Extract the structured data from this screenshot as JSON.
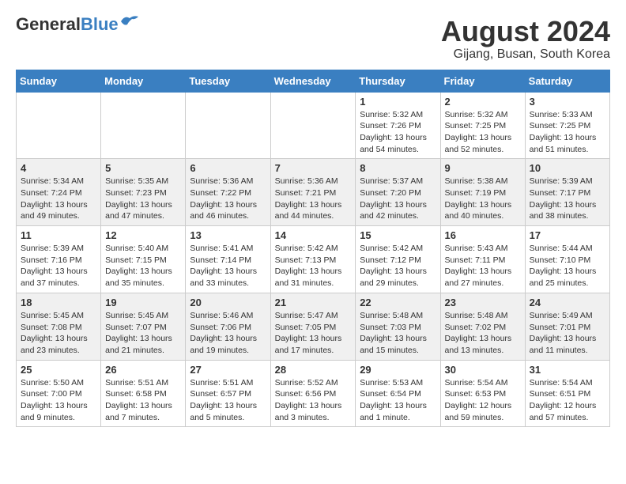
{
  "header": {
    "logo_general": "General",
    "logo_blue": "Blue",
    "month_year": "August 2024",
    "location": "Gijang, Busan, South Korea"
  },
  "days_of_week": [
    "Sunday",
    "Monday",
    "Tuesday",
    "Wednesday",
    "Thursday",
    "Friday",
    "Saturday"
  ],
  "weeks": [
    [
      {
        "day": "",
        "info": ""
      },
      {
        "day": "",
        "info": ""
      },
      {
        "day": "",
        "info": ""
      },
      {
        "day": "",
        "info": ""
      },
      {
        "day": "1",
        "info": "Sunrise: 5:32 AM\nSunset: 7:26 PM\nDaylight: 13 hours\nand 54 minutes."
      },
      {
        "day": "2",
        "info": "Sunrise: 5:32 AM\nSunset: 7:25 PM\nDaylight: 13 hours\nand 52 minutes."
      },
      {
        "day": "3",
        "info": "Sunrise: 5:33 AM\nSunset: 7:25 PM\nDaylight: 13 hours\nand 51 minutes."
      }
    ],
    [
      {
        "day": "4",
        "info": "Sunrise: 5:34 AM\nSunset: 7:24 PM\nDaylight: 13 hours\nand 49 minutes."
      },
      {
        "day": "5",
        "info": "Sunrise: 5:35 AM\nSunset: 7:23 PM\nDaylight: 13 hours\nand 47 minutes."
      },
      {
        "day": "6",
        "info": "Sunrise: 5:36 AM\nSunset: 7:22 PM\nDaylight: 13 hours\nand 46 minutes."
      },
      {
        "day": "7",
        "info": "Sunrise: 5:36 AM\nSunset: 7:21 PM\nDaylight: 13 hours\nand 44 minutes."
      },
      {
        "day": "8",
        "info": "Sunrise: 5:37 AM\nSunset: 7:20 PM\nDaylight: 13 hours\nand 42 minutes."
      },
      {
        "day": "9",
        "info": "Sunrise: 5:38 AM\nSunset: 7:19 PM\nDaylight: 13 hours\nand 40 minutes."
      },
      {
        "day": "10",
        "info": "Sunrise: 5:39 AM\nSunset: 7:17 PM\nDaylight: 13 hours\nand 38 minutes."
      }
    ],
    [
      {
        "day": "11",
        "info": "Sunrise: 5:39 AM\nSunset: 7:16 PM\nDaylight: 13 hours\nand 37 minutes."
      },
      {
        "day": "12",
        "info": "Sunrise: 5:40 AM\nSunset: 7:15 PM\nDaylight: 13 hours\nand 35 minutes."
      },
      {
        "day": "13",
        "info": "Sunrise: 5:41 AM\nSunset: 7:14 PM\nDaylight: 13 hours\nand 33 minutes."
      },
      {
        "day": "14",
        "info": "Sunrise: 5:42 AM\nSunset: 7:13 PM\nDaylight: 13 hours\nand 31 minutes."
      },
      {
        "day": "15",
        "info": "Sunrise: 5:42 AM\nSunset: 7:12 PM\nDaylight: 13 hours\nand 29 minutes."
      },
      {
        "day": "16",
        "info": "Sunrise: 5:43 AM\nSunset: 7:11 PM\nDaylight: 13 hours\nand 27 minutes."
      },
      {
        "day": "17",
        "info": "Sunrise: 5:44 AM\nSunset: 7:10 PM\nDaylight: 13 hours\nand 25 minutes."
      }
    ],
    [
      {
        "day": "18",
        "info": "Sunrise: 5:45 AM\nSunset: 7:08 PM\nDaylight: 13 hours\nand 23 minutes."
      },
      {
        "day": "19",
        "info": "Sunrise: 5:45 AM\nSunset: 7:07 PM\nDaylight: 13 hours\nand 21 minutes."
      },
      {
        "day": "20",
        "info": "Sunrise: 5:46 AM\nSunset: 7:06 PM\nDaylight: 13 hours\nand 19 minutes."
      },
      {
        "day": "21",
        "info": "Sunrise: 5:47 AM\nSunset: 7:05 PM\nDaylight: 13 hours\nand 17 minutes."
      },
      {
        "day": "22",
        "info": "Sunrise: 5:48 AM\nSunset: 7:03 PM\nDaylight: 13 hours\nand 15 minutes."
      },
      {
        "day": "23",
        "info": "Sunrise: 5:48 AM\nSunset: 7:02 PM\nDaylight: 13 hours\nand 13 minutes."
      },
      {
        "day": "24",
        "info": "Sunrise: 5:49 AM\nSunset: 7:01 PM\nDaylight: 13 hours\nand 11 minutes."
      }
    ],
    [
      {
        "day": "25",
        "info": "Sunrise: 5:50 AM\nSunset: 7:00 PM\nDaylight: 13 hours\nand 9 minutes."
      },
      {
        "day": "26",
        "info": "Sunrise: 5:51 AM\nSunset: 6:58 PM\nDaylight: 13 hours\nand 7 minutes."
      },
      {
        "day": "27",
        "info": "Sunrise: 5:51 AM\nSunset: 6:57 PM\nDaylight: 13 hours\nand 5 minutes."
      },
      {
        "day": "28",
        "info": "Sunrise: 5:52 AM\nSunset: 6:56 PM\nDaylight: 13 hours\nand 3 minutes."
      },
      {
        "day": "29",
        "info": "Sunrise: 5:53 AM\nSunset: 6:54 PM\nDaylight: 13 hours\nand 1 minute."
      },
      {
        "day": "30",
        "info": "Sunrise: 5:54 AM\nSunset: 6:53 PM\nDaylight: 12 hours\nand 59 minutes."
      },
      {
        "day": "31",
        "info": "Sunrise: 5:54 AM\nSunset: 6:51 PM\nDaylight: 12 hours\nand 57 minutes."
      }
    ]
  ]
}
